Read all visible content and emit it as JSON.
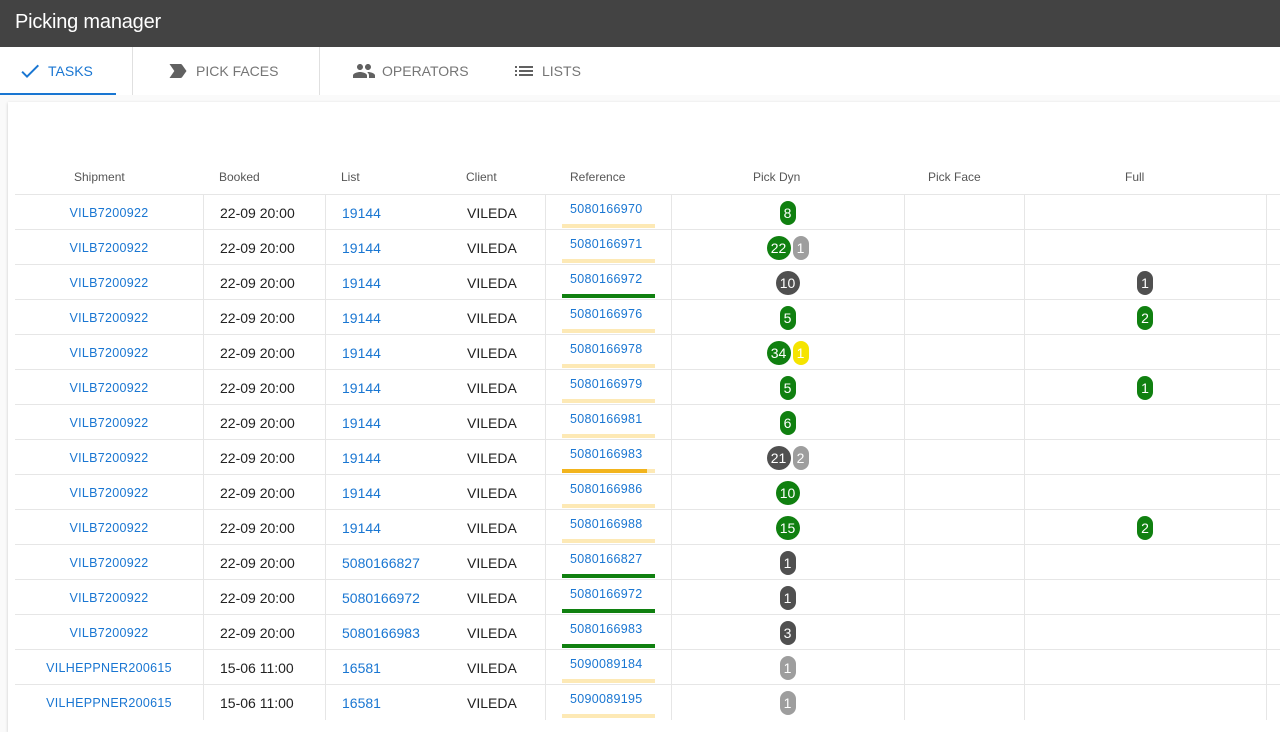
{
  "app": {
    "title": "Picking manager"
  },
  "tabs": [
    {
      "label": "TASKS",
      "icon": "check-icon"
    },
    {
      "label": "PICK FACES",
      "icon": "label-arrow-icon"
    },
    {
      "label": "OPERATORS",
      "icon": "people-icon"
    },
    {
      "label": "LISTS",
      "icon": "list-icon"
    }
  ],
  "columns": [
    "Shipment",
    "Booked",
    "List",
    "Client",
    "Reference",
    "Pick Dyn",
    "Pick Face",
    "Full"
  ],
  "colors": {
    "green": "#108010",
    "dark": "#505050",
    "grey": "#9e9e9e",
    "yellow": "#f5e400",
    "accent": "#1976d2",
    "bar_bg": "#fde9b5",
    "bar_orange": "#f2b41d"
  },
  "rows": [
    {
      "shipment": "VILB7200922",
      "booked": "22-09 20:00",
      "list": "19144",
      "client": "VILEDA",
      "reference": "5080166970",
      "bar": {
        "color": "none",
        "fill": 0
      },
      "pick_dyn": [
        {
          "value": "8",
          "color": "green"
        }
      ],
      "full": []
    },
    {
      "shipment": "VILB7200922",
      "booked": "22-09 20:00",
      "list": "19144",
      "client": "VILEDA",
      "reference": "5080166971",
      "bar": {
        "color": "none",
        "fill": 0
      },
      "pick_dyn": [
        {
          "value": "22",
          "color": "green"
        },
        {
          "value": "1",
          "color": "grey"
        }
      ],
      "full": []
    },
    {
      "shipment": "VILB7200922",
      "booked": "22-09 20:00",
      "list": "19144",
      "client": "VILEDA",
      "reference": "5080166972",
      "bar": {
        "color": "green",
        "fill": 1
      },
      "pick_dyn": [
        {
          "value": "10",
          "color": "dark"
        }
      ],
      "full": [
        {
          "value": "1",
          "color": "dark"
        }
      ]
    },
    {
      "shipment": "VILB7200922",
      "booked": "22-09 20:00",
      "list": "19144",
      "client": "VILEDA",
      "reference": "5080166976",
      "bar": {
        "color": "none",
        "fill": 0
      },
      "pick_dyn": [
        {
          "value": "5",
          "color": "green"
        }
      ],
      "full": [
        {
          "value": "2",
          "color": "green"
        }
      ]
    },
    {
      "shipment": "VILB7200922",
      "booked": "22-09 20:00",
      "list": "19144",
      "client": "VILEDA",
      "reference": "5080166978",
      "bar": {
        "color": "none",
        "fill": 0
      },
      "pick_dyn": [
        {
          "value": "34",
          "color": "green"
        },
        {
          "value": "1",
          "color": "yellow"
        }
      ],
      "full": []
    },
    {
      "shipment": "VILB7200922",
      "booked": "22-09 20:00",
      "list": "19144",
      "client": "VILEDA",
      "reference": "5080166979",
      "bar": {
        "color": "none",
        "fill": 0
      },
      "pick_dyn": [
        {
          "value": "5",
          "color": "green"
        }
      ],
      "full": [
        {
          "value": "1",
          "color": "green"
        }
      ]
    },
    {
      "shipment": "VILB7200922",
      "booked": "22-09 20:00",
      "list": "19144",
      "client": "VILEDA",
      "reference": "5080166981",
      "bar": {
        "color": "none",
        "fill": 0
      },
      "pick_dyn": [
        {
          "value": "6",
          "color": "green"
        }
      ],
      "full": []
    },
    {
      "shipment": "VILB7200922",
      "booked": "22-09 20:00",
      "list": "19144",
      "client": "VILEDA",
      "reference": "5080166983",
      "bar": {
        "color": "bar_orange",
        "fill": 0.91
      },
      "pick_dyn": [
        {
          "value": "21",
          "color": "dark"
        },
        {
          "value": "2",
          "color": "grey"
        }
      ],
      "full": []
    },
    {
      "shipment": "VILB7200922",
      "booked": "22-09 20:00",
      "list": "19144",
      "client": "VILEDA",
      "reference": "5080166986",
      "bar": {
        "color": "none",
        "fill": 0
      },
      "pick_dyn": [
        {
          "value": "10",
          "color": "green"
        }
      ],
      "full": []
    },
    {
      "shipment": "VILB7200922",
      "booked": "22-09 20:00",
      "list": "19144",
      "client": "VILEDA",
      "reference": "5080166988",
      "bar": {
        "color": "none",
        "fill": 0
      },
      "pick_dyn": [
        {
          "value": "15",
          "color": "green"
        }
      ],
      "full": [
        {
          "value": "2",
          "color": "green"
        }
      ]
    },
    {
      "shipment": "VILB7200922",
      "booked": "22-09 20:00",
      "list": "5080166827",
      "client": "VILEDA",
      "reference": "5080166827",
      "bar": {
        "color": "green",
        "fill": 1
      },
      "pick_dyn": [
        {
          "value": "1",
          "color": "dark"
        }
      ],
      "full": []
    },
    {
      "shipment": "VILB7200922",
      "booked": "22-09 20:00",
      "list": "5080166972",
      "client": "VILEDA",
      "reference": "5080166972",
      "bar": {
        "color": "green",
        "fill": 1
      },
      "pick_dyn": [
        {
          "value": "1",
          "color": "dark"
        }
      ],
      "full": []
    },
    {
      "shipment": "VILB7200922",
      "booked": "22-09 20:00",
      "list": "5080166983",
      "client": "VILEDA",
      "reference": "5080166983",
      "bar": {
        "color": "green",
        "fill": 1
      },
      "pick_dyn": [
        {
          "value": "3",
          "color": "dark"
        }
      ],
      "full": []
    },
    {
      "shipment": "VILHEPPNER200615",
      "booked": "15-06 11:00",
      "list": "16581",
      "client": "VILEDA",
      "reference": "5090089184",
      "bar": {
        "color": "none",
        "fill": 0
      },
      "pick_dyn": [
        {
          "value": "1",
          "color": "grey"
        }
      ],
      "full": []
    },
    {
      "shipment": "VILHEPPNER200615",
      "booked": "15-06 11:00",
      "list": "16581",
      "client": "VILEDA",
      "reference": "5090089195",
      "bar": {
        "color": "none",
        "fill": 0
      },
      "pick_dyn": [
        {
          "value": "1",
          "color": "grey"
        }
      ],
      "full": []
    }
  ]
}
